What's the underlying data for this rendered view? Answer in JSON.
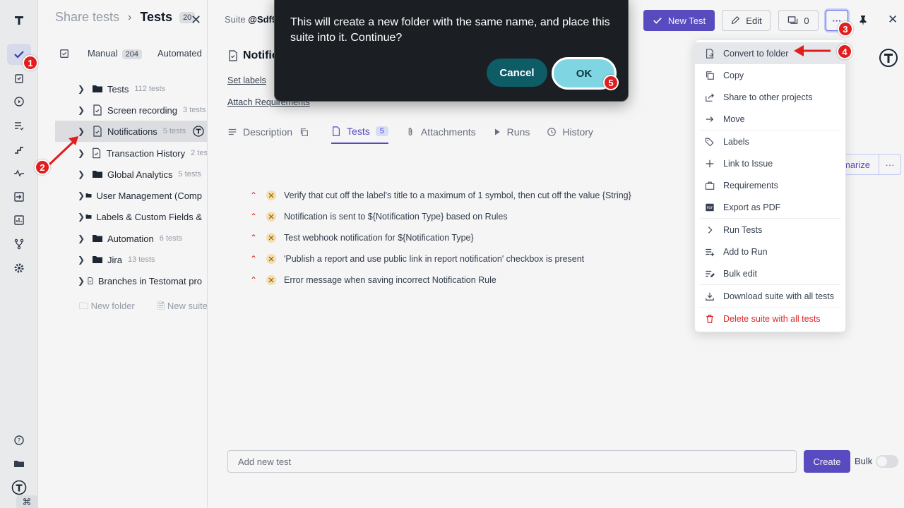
{
  "sidebar": {
    "nav_icons": [
      "tests-check-icon",
      "clipboard-icon",
      "play-circle-icon",
      "list-check-icon",
      "steps-icon",
      "pulse-icon",
      "import-icon",
      "bar-chart-icon",
      "branch-icon",
      "gear-icon"
    ],
    "bottom_icons": [
      "help-icon",
      "folders-icon",
      "testomat-logo-icon"
    ],
    "shortcut_key": "⌘"
  },
  "tree": {
    "breadcrumb_parent": "Share tests",
    "breadcrumb_current": "Tests",
    "count_badge": "20",
    "filter": {
      "manual_label": "Manual",
      "manual_count": "204",
      "automated_label": "Automated"
    },
    "items": [
      {
        "name": "Tests",
        "count": "112 tests",
        "type": "folder"
      },
      {
        "name": "Screen recording",
        "count": "3 tests",
        "type": "suite"
      },
      {
        "name": "Notifications",
        "count": "5 tests",
        "type": "suite"
      },
      {
        "name": "Transaction History",
        "count": "2 tes",
        "type": "suite"
      },
      {
        "name": "Global Analytics",
        "count": "5 tests",
        "type": "folder"
      },
      {
        "name": "User Management (Comp",
        "count": "",
        "type": "folder"
      },
      {
        "name": "Labels & Custom Fields &",
        "count": "",
        "type": "folder"
      },
      {
        "name": "Automation",
        "count": "6 tests",
        "type": "folder"
      },
      {
        "name": "Jira",
        "count": "13 tests",
        "type": "folder"
      },
      {
        "name": "Branches in Testomat pro",
        "count": "",
        "type": "suite"
      }
    ],
    "new_folder_label": "New folder",
    "new_suite_label": "New suite"
  },
  "main": {
    "suite_prefix": "Suite",
    "suite_id": "@Sdf9",
    "title": "Notific",
    "set_labels": "Set labels",
    "attach_requirements": "Attach Requirements",
    "tabs": [
      {
        "label": "Description",
        "badge": ""
      },
      {
        "label": "Tests",
        "badge": "5"
      },
      {
        "label": "Attachments",
        "badge": ""
      },
      {
        "label": "Runs",
        "badge": ""
      },
      {
        "label": "History",
        "badge": ""
      }
    ],
    "summarize_label": "marize",
    "tests": [
      "Verify that cut off the label's title to a maximum of 1 symbol, then cut off the value {String}",
      "Notification is sent to ${Notification Type} based on Rules",
      "Test webhook notification for ${Notification Type}",
      "'Publish a report and use public link in report notification' checkbox is present",
      "Error message when saving incorrect Notification Rule"
    ],
    "new_test_placeholder": "Add new test",
    "create_label": "Create",
    "bulk_label": "Bulk"
  },
  "toolbar": {
    "new_test": "New Test",
    "edit": "Edit",
    "comments_count": "0",
    "more": "···"
  },
  "menu": {
    "items": [
      {
        "label": "Convert to folder",
        "icon": "convert-folder-icon"
      },
      {
        "label": "Copy",
        "icon": "copy-icon"
      },
      {
        "label": "Share to other projects",
        "icon": "share-icon"
      },
      {
        "label": "Move",
        "icon": "arrow-right-icon"
      },
      {
        "label": "Labels",
        "icon": "tag-icon"
      },
      {
        "label": "Link to Issue",
        "icon": "plus-icon"
      },
      {
        "label": "Requirements",
        "icon": "briefcase-icon"
      },
      {
        "label": "Export as PDF",
        "icon": "pdf-icon"
      },
      {
        "label": "Run Tests",
        "icon": "chevron-right-icon"
      },
      {
        "label": "Add to Run",
        "icon": "list-plus-icon"
      },
      {
        "label": "Bulk edit",
        "icon": "list-edit-icon"
      },
      {
        "label": "Download suite with all tests",
        "icon": "download-icon"
      },
      {
        "label": "Delete suite with all tests",
        "icon": "trash-icon"
      }
    ]
  },
  "modal": {
    "message": "This will create a new folder with the same name, and place this suite into it. Continue?",
    "cancel": "Cancel",
    "ok": "OK"
  },
  "annotations": [
    "1",
    "2",
    "3",
    "4",
    "5"
  ],
  "colors": {
    "accent": "#5b4fc7",
    "danger": "#dc2626",
    "marker": "#e11d1d",
    "modal_bg": "#1b1f23",
    "ok_button": "#7fd6e2",
    "cancel_button": "#0e5c66"
  }
}
